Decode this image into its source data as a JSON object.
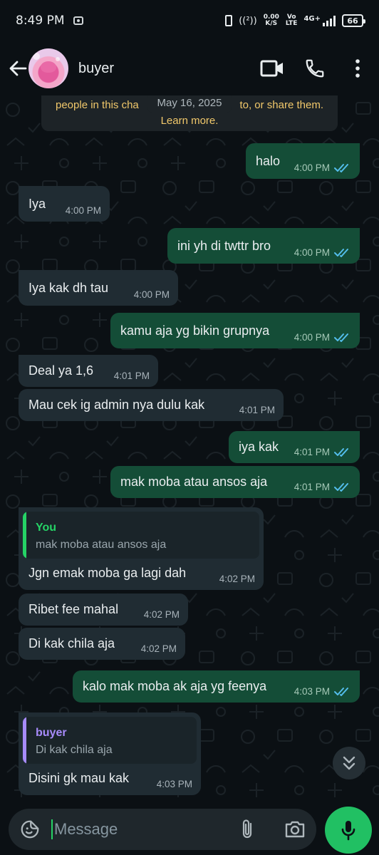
{
  "status_bar": {
    "time": "8:49 PM",
    "hotspot": "((²))",
    "speed_value": "0.00",
    "speed_unit": "K/S",
    "volte_top": "Vo",
    "volte_bottom": "LTE",
    "network": "4G+",
    "battery": "66"
  },
  "header": {
    "contact_name": "buyer",
    "icons": [
      "back-arrow-icon",
      "video-call-icon",
      "voice-call-icon",
      "more-options-icon"
    ]
  },
  "notice": {
    "line1_left": "people in this cha",
    "line1_right": "to, or share them.",
    "learn_more": "Learn more.",
    "date": "May 16, 2025"
  },
  "messages": [
    {
      "dir": "out",
      "text": "halo",
      "time": "4:00 PM",
      "read": true
    },
    {
      "dir": "in",
      "text": "Iya",
      "time": "4:00 PM"
    },
    {
      "dir": "out",
      "text": "ini yh di twttr bro",
      "time": "4:00 PM",
      "read": true
    },
    {
      "dir": "in",
      "text": "Iya kak dh tau",
      "time": "4:00 PM"
    },
    {
      "dir": "out",
      "text": "kamu aja yg bikin grupnya",
      "time": "4:00 PM",
      "read": true
    },
    {
      "dir": "in",
      "text": "Deal ya 1,6",
      "time": "4:01 PM"
    },
    {
      "dir": "in",
      "text": "Mau cek ig admin nya dulu kak",
      "time": "4:01 PM"
    },
    {
      "dir": "out",
      "text": "iya kak",
      "time": "4:01 PM",
      "read": true
    },
    {
      "dir": "out",
      "text": "mak moba atau ansos aja",
      "time": "4:01 PM",
      "read": true
    },
    {
      "dir": "in",
      "text": "Jgn emak moba ga lagi dah",
      "time": "4:02 PM",
      "quote_author": "You",
      "quote_text": "mak moba atau ansos aja"
    },
    {
      "dir": "in",
      "text": "Ribet fee mahal",
      "time": "4:02 PM"
    },
    {
      "dir": "in",
      "text": "Di kak chila aja",
      "time": "4:02 PM"
    },
    {
      "dir": "out",
      "text": "kalo mak moba ak aja yg feenya",
      "time": "4:03 PM",
      "read": true
    },
    {
      "dir": "in",
      "text": "Disini gk mau kak",
      "time": "4:03 PM",
      "quote_author": "buyer",
      "quote_text": "Di kak chila aja"
    }
  ],
  "composer": {
    "placeholder": "Message",
    "icons": [
      "sticker-icon",
      "attach-icon",
      "camera-icon",
      "mic-icon"
    ]
  },
  "colors": {
    "incoming_bubble": "#202c33",
    "outgoing_bubble": "#144d37",
    "read_ticks": "#53bdeb",
    "accent_green": "#21c063",
    "quote_you": "#25d366",
    "quote_buyer": "#a78bfa",
    "notice_text": "#f1c86b"
  }
}
